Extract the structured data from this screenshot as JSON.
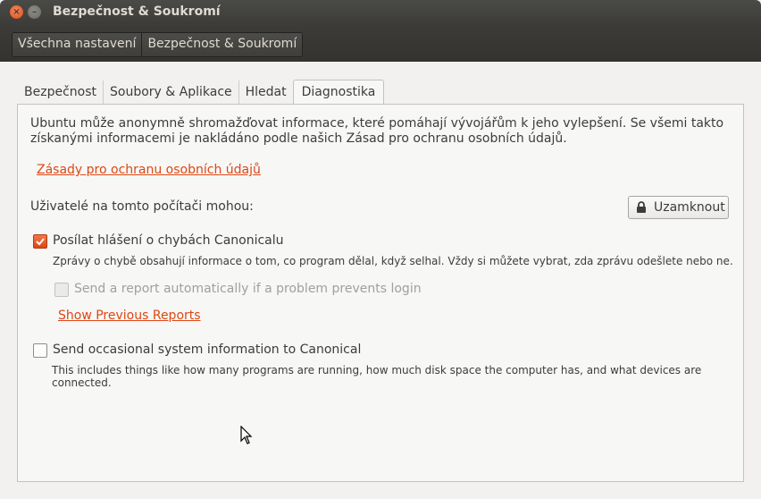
{
  "window": {
    "title": "Bezpečnost & Soukromí",
    "close_glyph": "×",
    "minimize_glyph": "–"
  },
  "breadcrumbs": [
    "Všechna nastavení",
    "Bezpečnost & Soukromí"
  ],
  "tabs": [
    {
      "label": "Bezpečnost",
      "active": false
    },
    {
      "label": "Soubory & Aplikace",
      "active": false
    },
    {
      "label": "Hledat",
      "active": false
    },
    {
      "label": "Diagnostika",
      "active": true
    }
  ],
  "diagnostics": {
    "intro_line1": "Ubuntu může anonymně shromažďovat informace, které pomáhají vývojářům k jeho vylepšení. Se všemi takto",
    "intro_line2": "získanými informacemi je nakládáno podle našich Zásad pro ochranu osobních údajů.",
    "privacy_link": "Zásady pro ochranu osobních údajů",
    "users_label": "Uživatelé na tomto počítači mohou:",
    "lock_button": "Uzamknout",
    "error_reports": {
      "label": "Posílat hlášení o chybách Canonicalu",
      "checked": true,
      "description": "Zprávy o chybě obsahují informace o tom, co program dělal, když selhal. Vždy si můžete vybrat, zda zprávu odešlete nebo ne."
    },
    "auto_report": {
      "label": "Send a report automatically if a problem prevents login",
      "checked": false,
      "disabled": true
    },
    "previous_reports_link": "Show Previous Reports",
    "system_info": {
      "label": "Send occasional system information to Canonical",
      "checked": false,
      "description": "This includes things like how many programs are running, how much disk space the computer has, and what devices are connected."
    }
  },
  "colors": {
    "accent": "#dd4814",
    "titlebar": "#3c3b37",
    "background": "#f2f1f0"
  }
}
